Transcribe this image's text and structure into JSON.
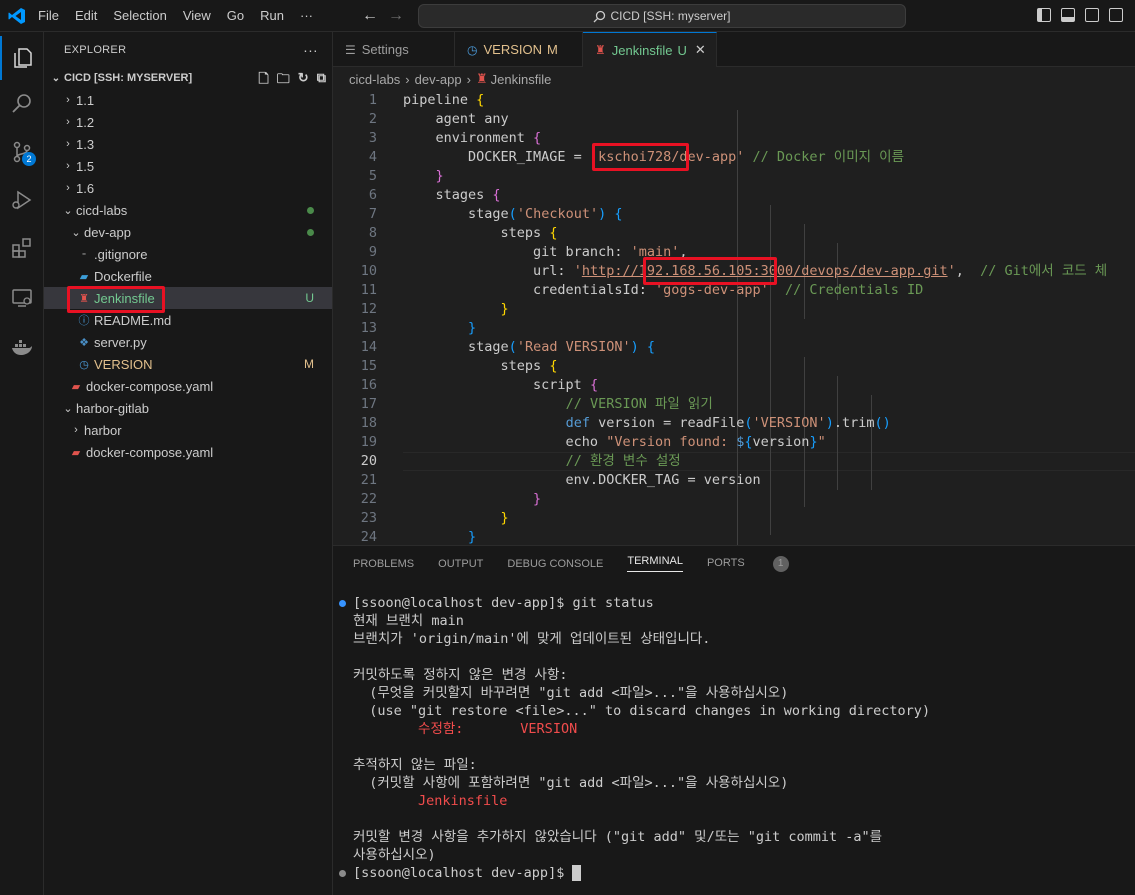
{
  "titlebar": {
    "menu": [
      "File",
      "Edit",
      "Selection",
      "View",
      "Go",
      "Run",
      "···"
    ],
    "search": "CICD [SSH: myserver]"
  },
  "activity": {
    "badge": "2"
  },
  "explorer": {
    "title": "EXPLORER",
    "more": "···",
    "section": "CICD [SSH: MYSERVER]",
    "items": [
      {
        "label": "1.1"
      },
      {
        "label": "1.2"
      },
      {
        "label": "1.3"
      },
      {
        "label": "1.5"
      },
      {
        "label": "1.6"
      },
      {
        "label": "cicd-labs"
      },
      {
        "label": "dev-app"
      },
      {
        "label": ".gitignore"
      },
      {
        "label": "Dockerfile"
      },
      {
        "label": "Jenkinsfile",
        "status": "U"
      },
      {
        "label": "README.md"
      },
      {
        "label": "server.py"
      },
      {
        "label": "VERSION",
        "status": "M"
      },
      {
        "label": "docker-compose.yaml"
      },
      {
        "label": "harbor-gitlab"
      },
      {
        "label": "harbor"
      },
      {
        "label": "docker-compose.yaml"
      }
    ]
  },
  "tabs": [
    {
      "label": "Settings"
    },
    {
      "label": "VERSION",
      "status": "M"
    },
    {
      "label": "Jenkinsfile",
      "status": "U"
    }
  ],
  "breadcrumb": [
    "cicd-labs",
    "dev-app",
    "Jenkinsfile"
  ],
  "editor": {
    "line_numbers": [
      "1",
      "2",
      "3",
      "4",
      "5",
      "6",
      "7",
      "8",
      "9",
      "10",
      "11",
      "12",
      "13",
      "14",
      "15",
      "16",
      "17",
      "18",
      "19",
      "20",
      "21",
      "22",
      "23",
      "24"
    ],
    "current_line": "20"
  },
  "panel": {
    "tabs": [
      "PROBLEMS",
      "OUTPUT",
      "DEBUG CONSOLE",
      "TERMINAL",
      "PORTS"
    ],
    "ports_badge": "1",
    "terminal_lines": [
      "[ssoon@localhost dev-app]$ git status",
      "현재 브랜치 main",
      "브랜치가 'origin/main'에 맞게 업데이트된 상태입니다.",
      "",
      "커밋하도록 정하지 않은 변경 사항:",
      "  (무엇을 커밋할지 바꾸려면 \"git add <파일>...\"을 사용하십시오)",
      "  (use \"git restore <file>...\" to discard changes in working directory)",
      "        수정함:       VERSION",
      "",
      "추적하지 않는 파일:",
      "  (커밋할 사항에 포함하려면 \"git add <파일>...\"을 사용하십시오)",
      "        Jenkinsfile",
      "",
      "커밋할 변경 사항을 추가하지 않았습니다 (\"git add\" 및/또는 \"git commit -a\"를",
      "사용하십시오)",
      "[ssoon@localhost dev-app]$ "
    ]
  }
}
